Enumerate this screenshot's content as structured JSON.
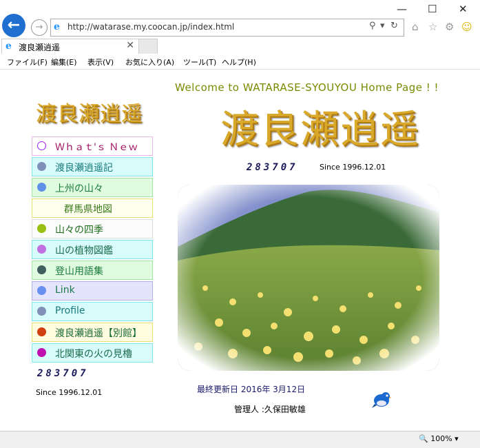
{
  "browser": {
    "address_url": "http://watarase.my.coocan.jp/index.html",
    "tab_title": "渡良瀬逍遥",
    "menu": [
      "ファイル(F)",
      "編集(E)",
      "表示(V)",
      "お気に入り(A)",
      "ツール(T)",
      "ヘルプ(H)"
    ],
    "zoom": "100%"
  },
  "page": {
    "welcome": "Welcome to WATARASE-SYOUYOU Home Page ! !",
    "logo_text": "渡良瀬逍遥",
    "counter": "283707",
    "since": "Since 1996.12.01",
    "updated": "最終更新日  2016年 3月12日",
    "admin": "管理人 :久保田敏雄"
  },
  "nav": [
    {
      "label": "Ｗｈａｔ'ｓ Ｎｅｗ",
      "bullet": "#ffffff",
      "bullet_border": "#a020f0",
      "bg": "#ffffff",
      "border": "#e8b8e8",
      "color": "#a01060"
    },
    {
      "label": "渡良瀬逍遥記",
      "bullet": "#8090b8",
      "bg": "#d8fcfc",
      "border": "#7ee6e6",
      "color": "#1a7a7a"
    },
    {
      "label": "上州の山々",
      "bullet": "#6090e8",
      "bg": "#e0fce0",
      "border": "#a0e8a0",
      "color": "#1a7a3a"
    },
    {
      "label": "群馬県地図",
      "bullet": "",
      "bg": "#fffff0",
      "border": "#e8e070",
      "color": "#3a7a1a"
    },
    {
      "label": "山々の四季",
      "bullet": "#98c010",
      "bg": "#fcfcfc",
      "border": "#dddddd",
      "color": "#1a6a1a"
    },
    {
      "label": "山の植物図鑑",
      "bullet": "#c070e0",
      "bg": "#d8fcfc",
      "border": "#7ee6e6",
      "color": "#1a6a4a"
    },
    {
      "label": "登山用語集",
      "bullet": "#406060",
      "bg": "#e0fce0",
      "border": "#a0e8a0",
      "color": "#1a7a3a"
    },
    {
      "label": "Link",
      "bullet": "#6890f0",
      "bg": "#e4e4fc",
      "border": "#b0b0e8",
      "color": "#1a7a4a"
    },
    {
      "label": "Profile",
      "bullet": "#8090b8",
      "bg": "#d8fcfc",
      "border": "#7ee6e6",
      "color": "#1a7a7a"
    },
    {
      "label": "渡良瀬逍遥【別館】",
      "bullet": "#d04010",
      "bg": "#fffce0",
      "border": "#e8e070",
      "color": "#1a6a3a"
    },
    {
      "label": "北関東の火の見櫓",
      "bullet": "#c010b0",
      "bg": "#d8fcfc",
      "border": "#7ee6e6",
      "color": "#1a6a4a"
    }
  ]
}
